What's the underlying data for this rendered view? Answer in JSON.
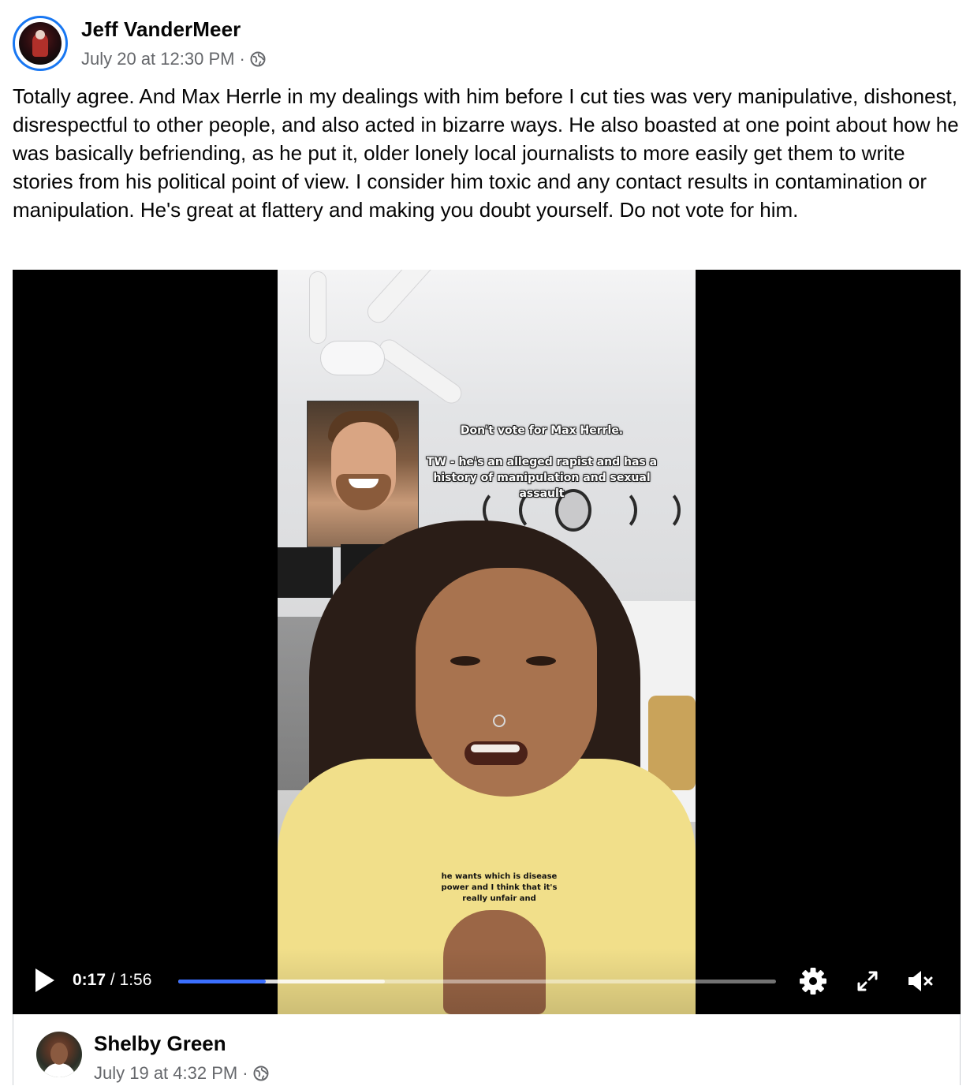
{
  "post": {
    "author": "Jeff VanderMeer",
    "timestamp": "July 20 at 12:30 PM",
    "separator": "·",
    "visibility_icon": "globe-icon",
    "text": "Totally agree. And Max Herrle in my dealings with him before I cut ties was very manipulative, dishonest, disrespectful to other people, and also acted in bizarre ways. He also boasted at one point about how he was basically befriending, as he put it, older lonely local journalists to more easily get them to write stories from his political point of view. I consider him toxic and any contact results in contamination or manipulation. He's great at flattery and making you doubt yourself. Do not vote for him."
  },
  "video": {
    "overlay_title": "Don't vote for Max Herrle.",
    "overlay_warning": "TW - he's an alleged rapist and has a history of manipulation and sexual assault",
    "caption": "he wants which is disease power and I think that it's really unfair and",
    "current_time": "0:17",
    "time_separator": " / ",
    "duration": "1:56",
    "played_fraction": 0.146,
    "buffered_fraction": 0.345,
    "icons": {
      "play": "play-icon",
      "settings": "gear-icon",
      "fullscreen": "expand-icon",
      "mute": "muted-speaker-icon"
    },
    "colors": {
      "progress": "#3b6fff",
      "background": "#000000"
    }
  },
  "comment": {
    "author": "Shelby Green",
    "timestamp": "July 19 at 4:32 PM",
    "separator": "·",
    "visibility_icon": "globe-icon"
  },
  "colors": {
    "accent": "#1877f2",
    "meta_text": "#65676b",
    "text": "#050505"
  }
}
